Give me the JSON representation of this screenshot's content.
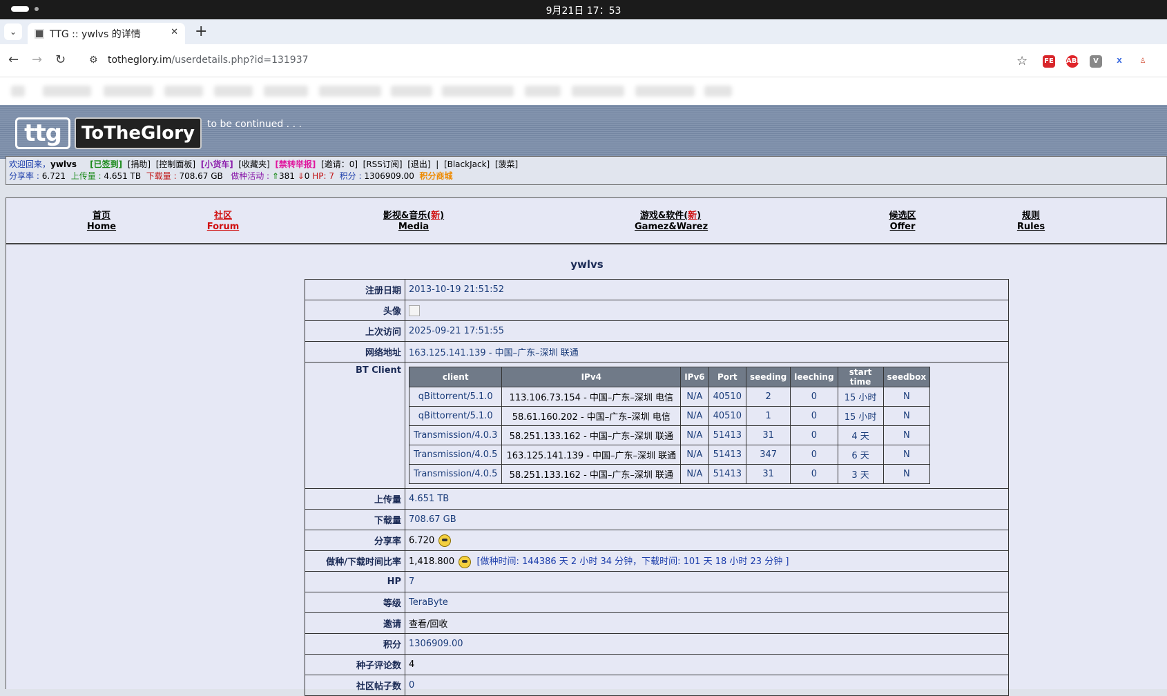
{
  "os": {
    "clock": "9月21日  17：53"
  },
  "browser": {
    "tab_title": "TTG :: ywlvs 的详情",
    "url_host": "totheglory.im",
    "url_path": "/userdetails.php?id=131937"
  },
  "site": {
    "logo_mark": "ttg",
    "logo_name": "ToTheGlory",
    "tagline": "to be continued . . ."
  },
  "infobar": {
    "welcome": "欢迎回来，",
    "user": "ywlvs",
    "links": [
      {
        "text": "[已签到]",
        "color": "green"
      },
      {
        "text": "[捐助]",
        "color": "black"
      },
      {
        "text": "[控制面板]",
        "color": "black"
      },
      {
        "text": "[小货车]",
        "color": "purple"
      },
      {
        "text": "[收藏夹]",
        "color": "black"
      },
      {
        "text": "[禁转举报]",
        "color": "magenta"
      },
      {
        "text": "[邀请：0]",
        "color": "black"
      },
      {
        "text": "[RSS订阅]",
        "color": "black"
      },
      {
        "text": "[退出]",
        "color": "black"
      },
      {
        "text": "|",
        "color": "black"
      },
      {
        "text": "[BlackJack]",
        "color": "black"
      },
      {
        "text": "[菠菜]",
        "color": "black"
      }
    ],
    "ratio_label": "分享率 :",
    "ratio": "6.721",
    "upload_label": "上传量 :",
    "upload": "4.651 TB",
    "download_label": "下载量 :",
    "download": "708.67 GB",
    "activity_label": "做种活动 :",
    "seeding": "381",
    "leeching": "0",
    "hp_label": "HP:",
    "hp": "7",
    "points_label": "积分 :",
    "points": "1306909.00",
    "shop": "积分商城"
  },
  "nav": [
    {
      "cn": "首页",
      "en": "Home"
    },
    {
      "cn": "社区",
      "en": "Forum"
    },
    {
      "cn": "影视&音乐(",
      "new": "新",
      "cn_end": ")",
      "en": "Media"
    },
    {
      "cn": "游戏&软件(",
      "new": "新",
      "cn_end": ")",
      "en": "Gamez&Warez"
    },
    {
      "cn": "候选区",
      "en": "Offer"
    },
    {
      "cn": "规则",
      "en": "Rules"
    }
  ],
  "profile": {
    "username": "ywlvs",
    "rows": {
      "reg_label": "注册日期",
      "reg": "2013-10-19 21:51:52",
      "avatar_label": "头像",
      "last_label": "上次访问",
      "last": "2025-09-21 17:51:55",
      "ip_label": "网络地址",
      "ip": "163.125.141.139 - 中国–广东–深圳 联通",
      "bt_label": "BT Client",
      "up_label": "上传量",
      "up": "4.651 TB",
      "down_label": "下载量",
      "down": "708.67 GB",
      "ratio_label": "分享率",
      "ratio": "6.720",
      "seedtime_label": "做种/下载时间比率",
      "seedtime_ratio": "1,418.800",
      "seedtime_detail": "[做种时间: 144386 天 2 小时 34 分钟，下载时间: 101 天 18 小时 23 分钟 ]",
      "hp_label": "HP",
      "hp": "7",
      "class_label": "等级",
      "class": "TeraByte",
      "invite_label": "邀请",
      "invite": "查看/回收",
      "points_label": "积分",
      "points": "1306909.00",
      "comments_label": "种子评论数",
      "comments": "4",
      "posts_label": "社区帖子数",
      "posts": "0"
    },
    "bt_headers": [
      "client",
      "IPv4",
      "IPv6",
      "Port",
      "seeding",
      "leeching",
      "start time",
      "seedbox"
    ],
    "bt_rows": [
      [
        "qBittorrent/5.1.0",
        "113.106.73.154 - 中国–广东–深圳 电信",
        "N/A",
        "40510",
        "2",
        "0",
        "15 小时",
        "N"
      ],
      [
        "qBittorrent/5.1.0",
        "58.61.160.202 - 中国–广东–深圳 电信",
        "N/A",
        "40510",
        "1",
        "0",
        "15 小时",
        "N"
      ],
      [
        "Transmission/4.0.3",
        "58.251.133.162 - 中国–广东–深圳 联通",
        "N/A",
        "51413",
        "31",
        "0",
        "4 天",
        "N"
      ],
      [
        "Transmission/4.0.5",
        "163.125.141.139 - 中国–广东–深圳 联通",
        "N/A",
        "51413",
        "347",
        "0",
        "6 天",
        "N"
      ],
      [
        "Transmission/4.0.5",
        "58.251.133.162 - 中国–广东–深圳 联通",
        "N/A",
        "51413",
        "31",
        "0",
        "3 天",
        "N"
      ]
    ]
  }
}
